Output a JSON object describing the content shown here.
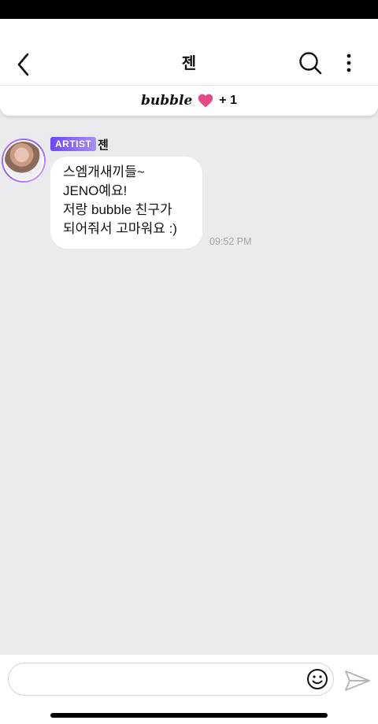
{
  "header": {
    "title": "젠",
    "back_icon": "chevron-left-icon",
    "search_icon": "search-icon",
    "more_icon": "more-vertical-icon"
  },
  "bubble_bar": {
    "brand": "bubble",
    "heart_icon": "heart-icon",
    "heart_color": "#e8478a",
    "count": "+ 1"
  },
  "message": {
    "badge": "ARTIST",
    "sender": "젠",
    "lines": [
      "스엠개새끼들~",
      "JENO예요!",
      "저랑 bubble 친구가",
      "되어줘서 고마워요 :)"
    ],
    "time": "09:52 PM"
  },
  "composer": {
    "placeholder": "",
    "value": "",
    "emoji_icon": "smiley-icon",
    "send_icon": "send-icon"
  },
  "colors": {
    "background": "#ebebed",
    "badge_gradient_start": "#6c48f5",
    "badge_gradient_end": "#a98cf8",
    "avatar_ring": "#8e5cf0"
  }
}
